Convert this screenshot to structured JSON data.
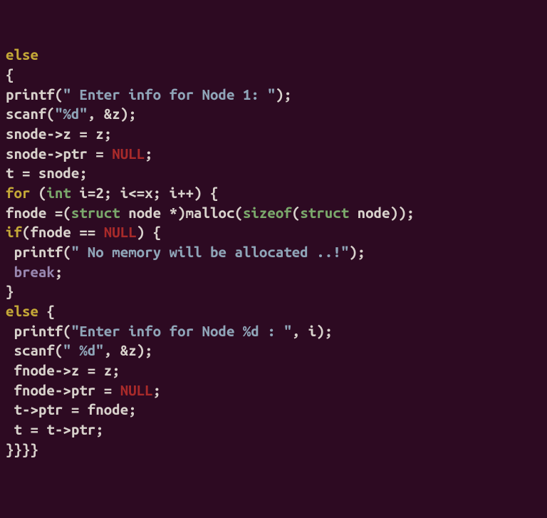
{
  "code": {
    "l01_kw": "else",
    "l02": "{",
    "l03_a": "printf(",
    "l03_str": "\" Enter info for Node 1: \"",
    "l03_b": ");",
    "l04_a": "scanf(",
    "l04_str": "\"%d\"",
    "l04_b": ", &z);",
    "l05": "snode->z = z;",
    "l06_a": "snode->ptr = ",
    "l06_null": "NULL",
    "l06_b": ";",
    "l07": "t = snode;",
    "l08_for": "for",
    "l08_a": " (",
    "l08_int": "int",
    "l08_b": " i=2; i<=x; i++) {",
    "l09_a": "fnode =(",
    "l09_struct1": "struct",
    "l09_b": " node *)malloc(",
    "l09_sizeof": "sizeof",
    "l09_c": "(",
    "l09_struct2": "struct",
    "l09_d": " node));",
    "l10_if": "if",
    "l10_a": "(fnode == ",
    "l10_null": "NULL",
    "l10_b": ") {",
    "l11_a": " printf(",
    "l11_str": "\" No memory will be allocated ..!\"",
    "l11_b": ");",
    "l12_br": " break",
    "l12_b": ";",
    "l13": "}",
    "l14_else": "else",
    "l14_b": " {",
    "l15_a": " printf(",
    "l15_str": "\"Enter info for Node %d : \"",
    "l15_b": ", i);",
    "l16_a": " scanf(",
    "l16_str": "\" %d\"",
    "l16_b": ", &z);",
    "l17": " fnode->z = z;",
    "l18_a": " fnode->ptr = ",
    "l18_null": "NULL",
    "l18_b": ";",
    "l19": " t->ptr = fnode;",
    "l20": " t = t->ptr;",
    "l21": "}}}}"
  }
}
